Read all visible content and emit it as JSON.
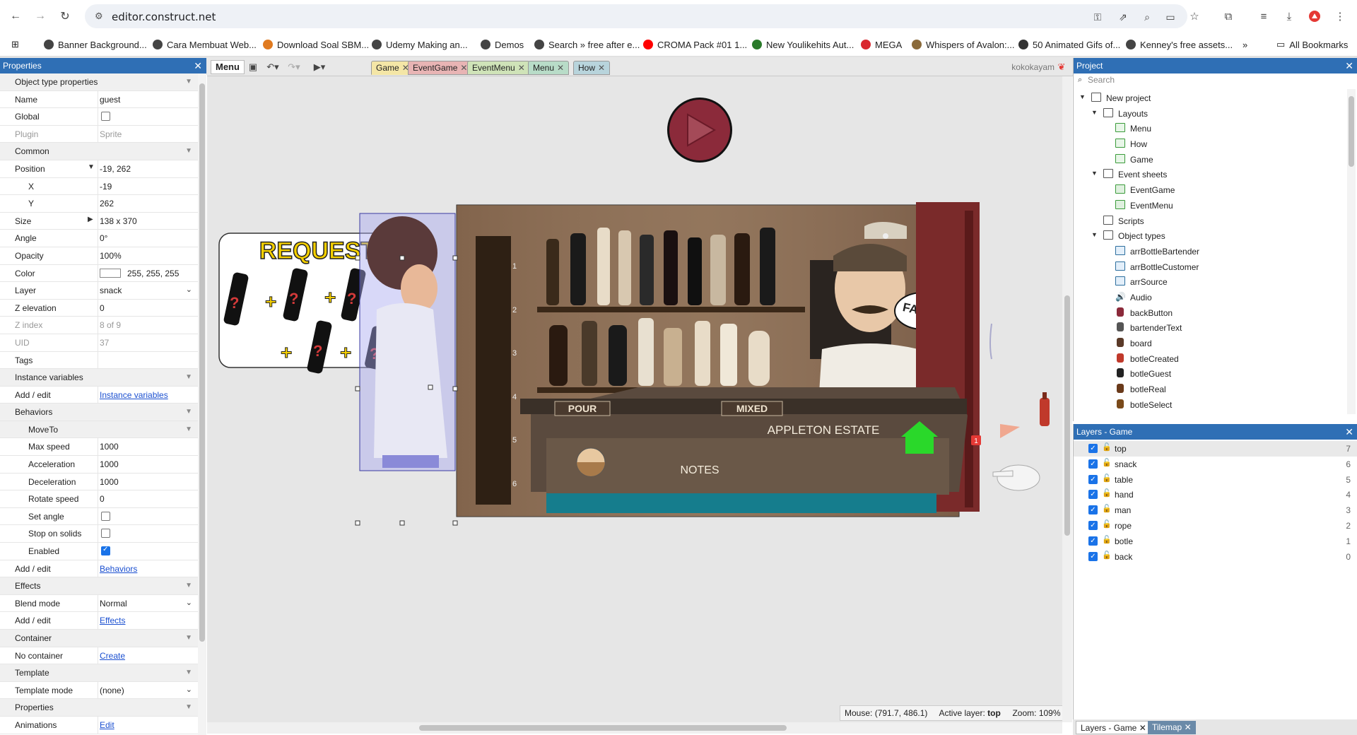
{
  "browser": {
    "url": "editor.construct.net",
    "bookmarks": [
      {
        "label": "Banner Background...",
        "color": "#444444"
      },
      {
        "label": "Cara Membuat Web...",
        "color": "#444444"
      },
      {
        "label": "Download Soal SBM...",
        "color": "#e07a1f"
      },
      {
        "label": "Udemy Making an...",
        "color": "#444444"
      },
      {
        "label": "Demos",
        "color": "#444444"
      },
      {
        "label": "Search » free after e...",
        "color": "#444444"
      },
      {
        "label": "CROMA Pack #01 1...",
        "color": "#ff0000"
      },
      {
        "label": "New Youlikehits Aut...",
        "color": "#2a7a2a"
      },
      {
        "label": "MEGA",
        "color": "#d9272e"
      },
      {
        "label": "Whispers of Avalon:...",
        "color": "#8a6a3a"
      },
      {
        "label": "50 Animated Gifs of...",
        "color": "#333333"
      },
      {
        "label": "Kenney's free assets...",
        "color": "#444444"
      }
    ],
    "more_bookmarks": "»",
    "all_bookmarks": "All Bookmarks"
  },
  "properties": {
    "title": "Properties",
    "rows": [
      {
        "type": "section",
        "name": "Object type properties"
      },
      {
        "type": "text",
        "name": "Name",
        "value": "guest"
      },
      {
        "type": "check",
        "name": "Global",
        "checked": false
      },
      {
        "type": "text",
        "name": "Plugin",
        "value": "Sprite",
        "grey": true
      },
      {
        "type": "section",
        "name": "Common"
      },
      {
        "type": "text",
        "name": "Position",
        "value": "-19, 262",
        "arrow": "▼"
      },
      {
        "type": "text",
        "name": "X",
        "value": "-19",
        "sub": true
      },
      {
        "type": "text",
        "name": "Y",
        "value": "262",
        "sub": true
      },
      {
        "type": "text",
        "name": "Size",
        "value": "138 x 370",
        "arrow": "▶"
      },
      {
        "type": "text",
        "name": "Angle",
        "value": "0°"
      },
      {
        "type": "text",
        "name": "Opacity",
        "value": "100%"
      },
      {
        "type": "color",
        "name": "Color",
        "value": "255, 255, 255"
      },
      {
        "type": "select",
        "name": "Layer",
        "value": "snack"
      },
      {
        "type": "text",
        "name": "Z elevation",
        "value": "0"
      },
      {
        "type": "text",
        "name": "Z index",
        "value": "8 of 9",
        "grey": true
      },
      {
        "type": "text",
        "name": "UID",
        "value": "37",
        "grey": true
      },
      {
        "type": "text",
        "name": "Tags",
        "value": ""
      },
      {
        "type": "section",
        "name": "Instance variables"
      },
      {
        "type": "link",
        "name": "Add / edit",
        "value": "Instance variables"
      },
      {
        "type": "section",
        "name": "Behaviors"
      },
      {
        "type": "section",
        "name": "MoveTo",
        "sub": true
      },
      {
        "type": "text",
        "name": "Max speed",
        "value": "1000",
        "sub": true
      },
      {
        "type": "text",
        "name": "Acceleration",
        "value": "1000",
        "sub": true
      },
      {
        "type": "text",
        "name": "Deceleration",
        "value": "1000",
        "sub": true
      },
      {
        "type": "text",
        "name": "Rotate speed",
        "value": "0",
        "sub": true
      },
      {
        "type": "check",
        "name": "Set angle",
        "checked": false,
        "sub": true
      },
      {
        "type": "check",
        "name": "Stop on solids",
        "checked": false,
        "sub": true
      },
      {
        "type": "check",
        "name": "Enabled",
        "checked": true,
        "sub": true
      },
      {
        "type": "link",
        "name": "Add / edit",
        "value": "Behaviors"
      },
      {
        "type": "section",
        "name": "Effects"
      },
      {
        "type": "select",
        "name": "Blend mode",
        "value": "Normal"
      },
      {
        "type": "link",
        "name": "Add / edit",
        "value": "Effects"
      },
      {
        "type": "section",
        "name": "Container"
      },
      {
        "type": "link",
        "name": "No container",
        "value": "Create"
      },
      {
        "type": "section",
        "name": "Template"
      },
      {
        "type": "select",
        "name": "Template mode",
        "value": "(none)"
      },
      {
        "type": "section",
        "name": "Properties"
      },
      {
        "type": "link",
        "name": "Animations",
        "value": "Edit"
      }
    ]
  },
  "toolbar": {
    "menu_label": "Menu",
    "tabs": [
      {
        "label": "Game",
        "color": "#f4e6a6",
        "active": true
      },
      {
        "label": "EventGame",
        "color": "#e8b4b4"
      },
      {
        "label": "EventMenu",
        "color": "#cfe3b8"
      },
      {
        "label": "Menu",
        "color": "#b8dcc8"
      },
      {
        "label": "How",
        "color": "#b8d4dc"
      }
    ],
    "user": "kokokayam"
  },
  "scene": {
    "request_label": "REQUEST",
    "pour_label": "POUR",
    "mixed_label": "MIXED",
    "notes_label": "NOTES",
    "brand_label": "APPLETON ESTATE",
    "failed_label": "FAILED",
    "shelf_numbers": [
      "1",
      "2",
      "3",
      "4",
      "5",
      "6"
    ],
    "badge": "1"
  },
  "status": {
    "mouse_label": "Mouse:",
    "mouse_value": "(791.7, 486.1)",
    "active_layer_label": "Active layer:",
    "active_layer_value": "top",
    "zoom_label": "Zoom:",
    "zoom_value": "109%"
  },
  "project": {
    "title": "Project",
    "search_placeholder": "Search",
    "tree": [
      {
        "level": 0,
        "twisty": "▼",
        "icon": "folder",
        "label": "New project"
      },
      {
        "level": 1,
        "twisty": "▼",
        "icon": "folder",
        "label": "Layouts"
      },
      {
        "level": 2,
        "icon": "layout",
        "label": "Menu"
      },
      {
        "level": 2,
        "icon": "layout",
        "label": "How"
      },
      {
        "level": 2,
        "icon": "layout",
        "label": "Game"
      },
      {
        "level": 1,
        "twisty": "▼",
        "icon": "folder",
        "label": "Event sheets"
      },
      {
        "level": 2,
        "icon": "events",
        "label": "EventGame"
      },
      {
        "level": 2,
        "icon": "events",
        "label": "EventMenu"
      },
      {
        "level": 1,
        "icon": "folder",
        "label": "Scripts"
      },
      {
        "level": 1,
        "twisty": "▼",
        "icon": "folder",
        "label": "Object types"
      },
      {
        "level": 2,
        "icon": "array",
        "label": "arrBottleBartender"
      },
      {
        "level": 2,
        "icon": "array",
        "label": "arrBottleCustomer"
      },
      {
        "level": 2,
        "icon": "array",
        "label": "arrSource"
      },
      {
        "level": 2,
        "icon": "audio",
        "label": "Audio"
      },
      {
        "level": 2,
        "icon": "sprite",
        "color": "#8b2a3a",
        "label": "backButton"
      },
      {
        "level": 2,
        "icon": "sprite",
        "color": "#555555",
        "label": "bartenderText"
      },
      {
        "level": 2,
        "icon": "sprite",
        "color": "#5a3a28",
        "label": "board"
      },
      {
        "level": 2,
        "icon": "sprite",
        "color": "#c0392b",
        "label": "botleCreated"
      },
      {
        "level": 2,
        "icon": "sprite",
        "color": "#222222",
        "label": "botleGuest"
      },
      {
        "level": 2,
        "icon": "sprite",
        "color": "#6a3a1a",
        "label": "botleReal"
      },
      {
        "level": 2,
        "icon": "sprite",
        "color": "#7a4a1a",
        "label": "botleSelect"
      }
    ]
  },
  "layers": {
    "title": "Layers - Game",
    "items": [
      {
        "name": "top",
        "index": "7",
        "selected": true
      },
      {
        "name": "snack",
        "index": "6"
      },
      {
        "name": "table",
        "index": "5"
      },
      {
        "name": "hand",
        "index": "4"
      },
      {
        "name": "man",
        "index": "3"
      },
      {
        "name": "rope",
        "index": "2"
      },
      {
        "name": "botle",
        "index": "1"
      },
      {
        "name": "back",
        "index": "0"
      }
    ],
    "bottom_tabs": [
      "Layers - Game",
      "Tilemap"
    ]
  }
}
